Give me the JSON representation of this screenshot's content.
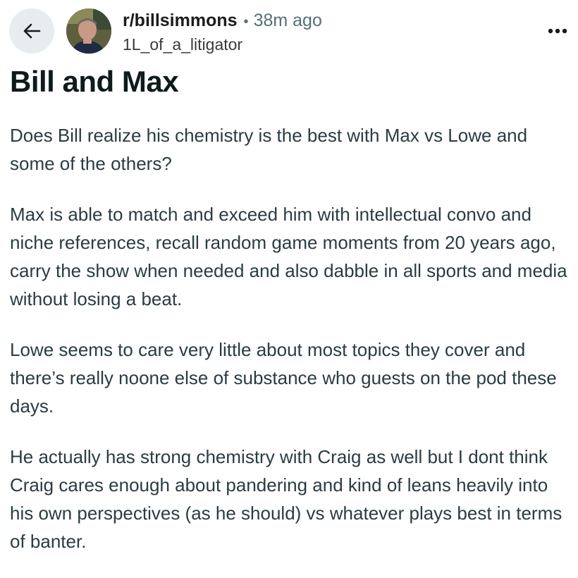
{
  "post": {
    "subreddit": "r/billsimmons",
    "separator": "•",
    "time_ago": "38m ago",
    "author": "1L_of_a_litigator",
    "title": "Bill and Max",
    "paragraphs": [
      "Does Bill realize his chemistry is the best with Max vs Lowe and some of the others?",
      "Max is able to match and exceed him with intellectual convo and niche references, recall random game moments from 20 years ago, carry the show when needed and also dabble in all sports and media without losing a beat.",
      "Lowe seems to care very little about most topics they cover and there’s really noone else of substance who guests on the pod these days.",
      "He actually has strong chemistry with Craig as well but I dont think Craig cares enough about pandering and kind of leans heavily into his own perspectives (as he should) vs whatever plays best in terms of banter."
    ]
  },
  "icons": {
    "back": "arrow-left-icon",
    "more": "more-horizontal-icon"
  },
  "colors": {
    "back_button_bg": "#e9ecee",
    "meta_gray": "#576f76",
    "body_text": "#2a3c42",
    "title_text": "#0f1a1c"
  }
}
